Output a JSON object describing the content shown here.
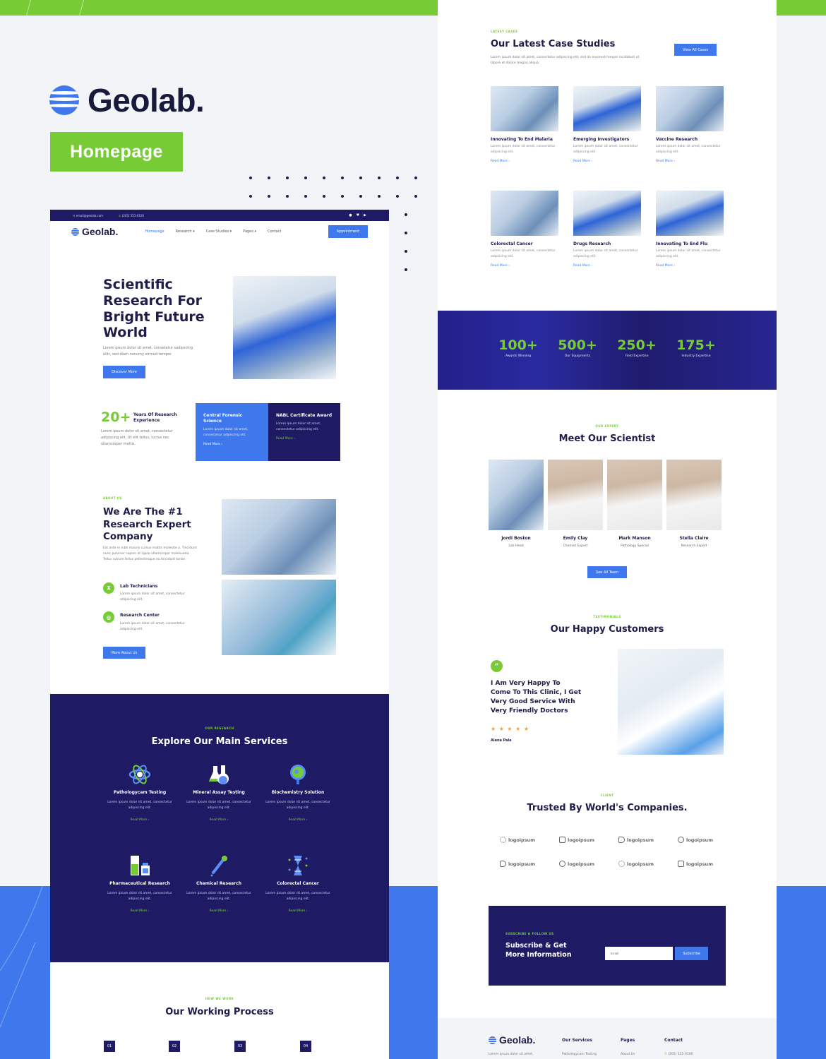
{
  "brand": {
    "name": "Geolab.",
    "tag": "Homepage"
  },
  "colors": {
    "green": "#77cc36",
    "blue": "#3f77ec",
    "navy": "#1e1a63",
    "dark": "#1e1d4a"
  },
  "left": {
    "topbar": {
      "email": "email@geolab.com",
      "phone": "(205) 555-0100",
      "social": [
        "facebook-icon",
        "twitter-icon",
        "youtube-icon"
      ]
    },
    "nav": {
      "logo": "Geolab.",
      "items": [
        "Homepage",
        "Research ▾",
        "Case Studies ▾",
        "Pages ▾",
        "Contact"
      ],
      "cta": "Appointment"
    },
    "hero": {
      "title_lines": [
        "Scientific",
        "Research For",
        "Bright Future",
        "World"
      ],
      "text": "Lorem ipsum dolor sit amet, consetetur sadipscing elitr, sed diam nonumy eirmod tempor",
      "button": "Discover More"
    },
    "experience": {
      "number": "20+",
      "label": "Years Of Research Experience",
      "text": "Lorem ipsum dolor sit amet, consectetur adipiscing elit. Ut elit tellus, luctus nec ullamcorper mattis."
    },
    "feature_cards": [
      {
        "title": "Central Forensic Science",
        "text": "Lorem ipsum dolor sit amet, consectetur adipiscing elit.",
        "link": "Read More ›"
      },
      {
        "title": "NABL Certificate Award",
        "text": "Lorem ipsum dolor sit amet, consectetur adipiscing elit.",
        "link": "Read More ›"
      }
    ],
    "about": {
      "eyebrow": "ABOUT US",
      "title_lines": [
        "We Are The #1",
        "Research Expert",
        "Company"
      ],
      "text": "Est ante in nibh mauris cursus mattis molestie a. Tincidunt nunc pulvinar sapien et ligula ullamcorper malesuada. Tellus rutrum tellus pellentesque eu tincidunt tortor.",
      "items": [
        {
          "title": "Lab Technicians",
          "text": "Lorem ipsum dolor sit amet, consectetur adipiscing elit."
        },
        {
          "title": "Research Center",
          "text": "Lorem ipsum dolor sit amet, consectetur adipiscing elit."
        }
      ],
      "button": "More About Us"
    },
    "services": {
      "eyebrow": "OUR RESEARCH",
      "title": "Explore Our Main Services",
      "items": [
        {
          "title": "Pathologycam Testing",
          "icon": "atom-icon",
          "text": "Lorem ipsum dolor sit amet, consectetur adipiscing elit.",
          "link": "Read More ›"
        },
        {
          "title": "Mineral Assay Testing",
          "icon": "flask-icon",
          "text": "Lorem ipsum dolor sit amet, consectetur adipiscing elit.",
          "link": "Read More ›"
        },
        {
          "title": "Biochemistry Solution",
          "icon": "magnifier-icon",
          "text": "Lorem ipsum dolor sit amet, consectetur adipiscing elit.",
          "link": "Read More ›"
        },
        {
          "title": "Pharmaceutical Research",
          "icon": "medicine-bottle-icon",
          "text": "Lorem ipsum dolor sit amet, consectetur adipiscing elit.",
          "link": "Read More ›"
        },
        {
          "title": "Chemical Research",
          "icon": "dropper-icon",
          "text": "Lorem ipsum dolor sit amet, consectetur adipiscing elit.",
          "link": "Read More ›"
        },
        {
          "title": "Colorectal Cancer",
          "icon": "dna-icon",
          "text": "Lorem ipsum dolor sit amet, consectetur adipiscing elit.",
          "link": "Read More ›"
        }
      ]
    },
    "process": {
      "eyebrow": "HOW WE WORK",
      "title": "Our Working Process",
      "steps": [
        "01",
        "02",
        "03",
        "04"
      ]
    }
  },
  "right": {
    "cases": {
      "eyebrow": "LATEST CASES",
      "title": "Our Latest Case Studies",
      "text": "Lorem ipsum dolor sit amet, consectetur adipiscing elit, sed do eiusmod tempor incididunt ut labore et dolore magna aliqua.",
      "button": "View All Cases",
      "items": [
        {
          "title": "Innovating To End Malaria",
          "text": "Lorem ipsum dolor sit amet, consectetur adipiscing elit.",
          "link": "Read More ›"
        },
        {
          "title": "Emerging Investigators",
          "text": "Lorem ipsum dolor sit amet, consectetur adipiscing elit.",
          "link": "Read More ›"
        },
        {
          "title": "Vaccine Research",
          "text": "Lorem ipsum dolor sit amet, consectetur adipiscing elit.",
          "link": "Read More ›"
        },
        {
          "title": "Colorectal Cancer",
          "text": "Lorem ipsum dolor sit amet, consectetur adipiscing elit.",
          "link": "Read More ›"
        },
        {
          "title": "Drugs Research",
          "text": "Lorem ipsum dolor sit amet, consectetur adipiscing elit.",
          "link": "Read More ›"
        },
        {
          "title": "Innovating To End Flu",
          "text": "Lorem ipsum dolor sit amet, consectetur adipiscing elit.",
          "link": "Read More ›"
        }
      ]
    },
    "stats": [
      {
        "value": "100+",
        "label": "Awards Winning"
      },
      {
        "value": "500+",
        "label": "Our Equipments"
      },
      {
        "value": "250+",
        "label": "Field Expertise"
      },
      {
        "value": "175+",
        "label": "Industry Expertise"
      }
    ],
    "team": {
      "eyebrow": "OUR EXPERT",
      "title": "Meet Our Scientist",
      "members": [
        {
          "name": "Jordi Boston",
          "role": "Lab Head"
        },
        {
          "name": "Emily Clay",
          "role": "Chemist Expert"
        },
        {
          "name": "Mark Manson",
          "role": "Pathology Special"
        },
        {
          "name": "Stella Claire",
          "role": "Research Expert"
        }
      ],
      "button": "See All Team"
    },
    "testimonials": {
      "eyebrow": "TESTIMONIALS",
      "title": "Our Happy Customers",
      "quote_lines": [
        "I Am Very Happy To",
        "Come To This Clinic, I Get",
        "Very Good Service With",
        "Very Friendly Doctors"
      ],
      "rating": 5,
      "rating_max": 5,
      "stars": "★ ★ ★ ★ ★",
      "author": "Alena Pale"
    },
    "clients": {
      "eyebrow": "CLIENT",
      "title": "Trusted By World's Companies.",
      "logos": [
        "logoipsum",
        "logoipsum",
        "logoipsum",
        "logoipsum",
        "logoipsum",
        "logoipsum",
        "logoipsum",
        "logoipsum"
      ]
    },
    "subscribe": {
      "eyebrow": "SUBSCRIBE & FOLLOW US",
      "title_lines": [
        "Subscribe & Get",
        "More Information"
      ],
      "input_label": "Email",
      "placeholder": "Email",
      "button": "Subscribe"
    },
    "footer": {
      "logo": "Geolab.",
      "about": "Lorem ipsum dolor sit amet,",
      "columns": [
        {
          "title": "Our Services",
          "first": "Pathologycam Testing"
        },
        {
          "title": "Pages",
          "first": "About Us"
        },
        {
          "title": "Contact",
          "first": "(205) 555-0100"
        }
      ]
    }
  }
}
